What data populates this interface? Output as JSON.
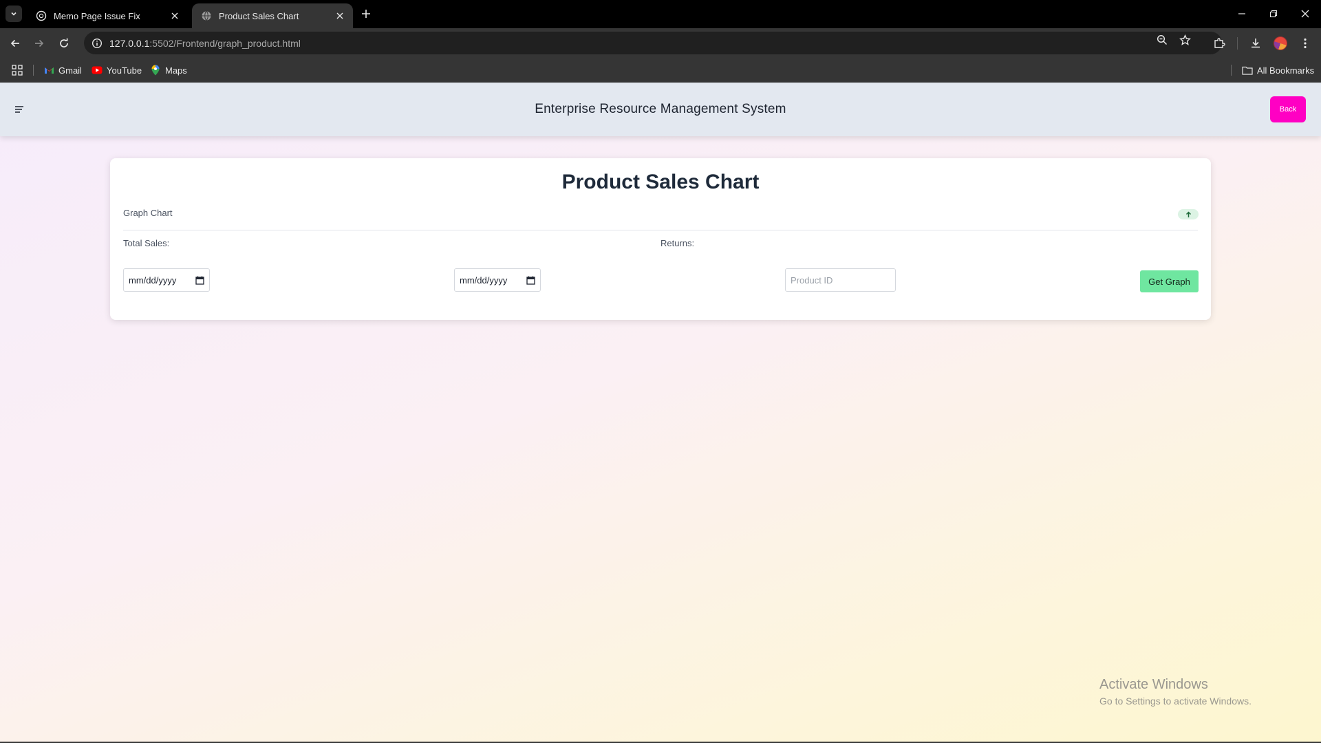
{
  "browser": {
    "tabs": [
      {
        "title": "Memo Page Issue Fix",
        "favicon": "chatgpt-icon",
        "active": false
      },
      {
        "title": "Product Sales Chart",
        "favicon": "globe-icon",
        "active": true
      }
    ],
    "url": {
      "host": "127.0.0.1",
      "rest": ":5502/Frontend/graph_product.html"
    },
    "bookmarks": [
      {
        "label": "Gmail",
        "icon": "gmail-icon"
      },
      {
        "label": "YouTube",
        "icon": "youtube-icon"
      },
      {
        "label": "Maps",
        "icon": "maps-icon"
      }
    ],
    "all_bookmarks": "All Bookmarks"
  },
  "header": {
    "title": "Enterprise Resource Management System",
    "back_label": "Back",
    "back_color": "#ff00c3"
  },
  "card": {
    "title": "Product Sales Chart",
    "graph_label": "Graph Chart",
    "total_sales_label": "Total Sales:",
    "returns_label": "Returns:",
    "start_date": "mm/dd/yyyy",
    "end_date": "mm/dd/yyyy",
    "product_placeholder": "Product ID",
    "get_graph_label": "Get Graph",
    "get_graph_color": "#6fe6a0"
  },
  "watermark": {
    "line1": "Activate Windows",
    "line2": "Go to Settings to activate Windows."
  }
}
